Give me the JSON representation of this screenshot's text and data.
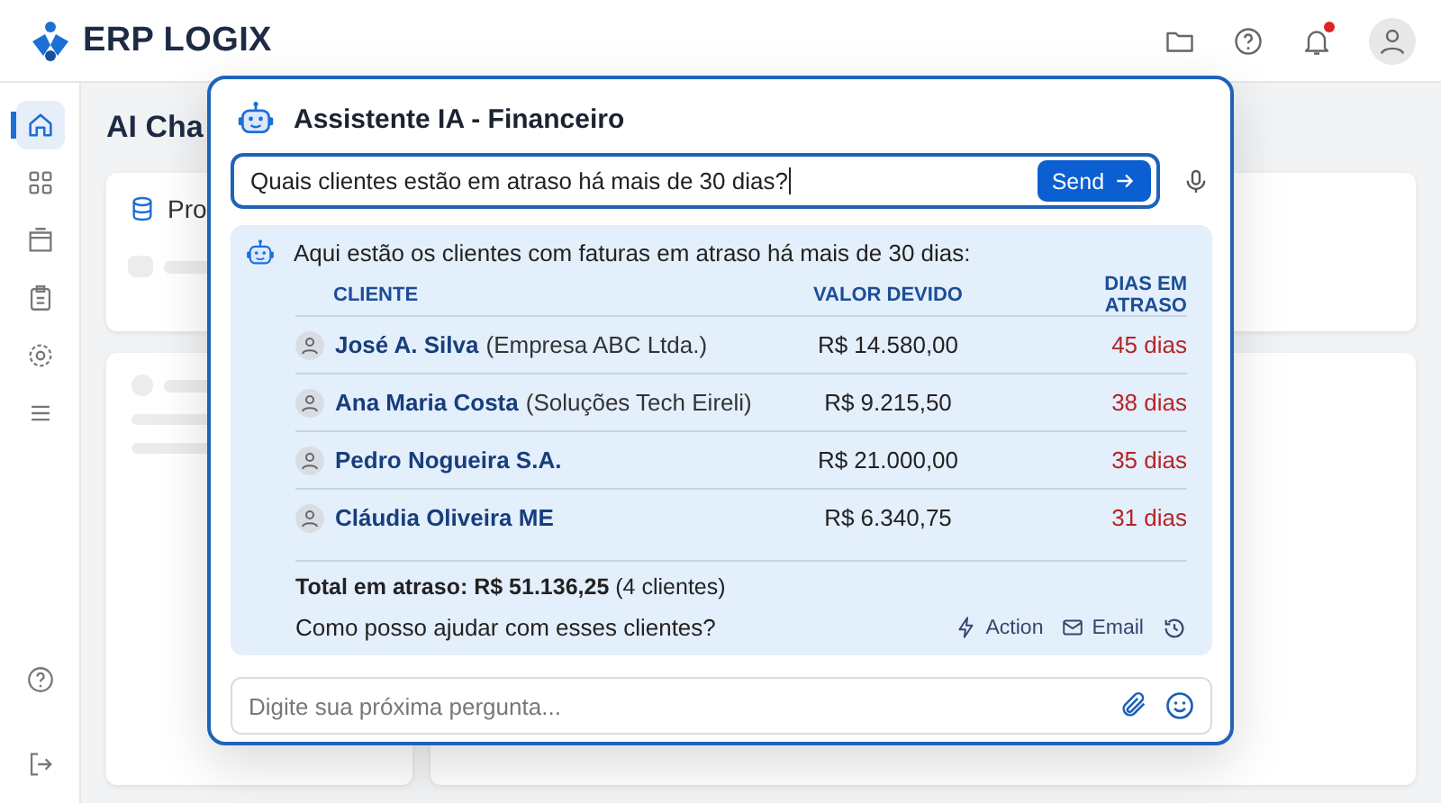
{
  "app": {
    "logo_text": "ERP LOGIX"
  },
  "sidebar": {
    "items": [
      {
        "selected": true
      },
      {
        "selected": false
      },
      {
        "selected": false
      },
      {
        "selected": false
      },
      {
        "selected": false
      },
      {
        "selected": false
      }
    ]
  },
  "header": {
    "notifications_unread": true
  },
  "page": {
    "title": "AI Cha",
    "card_title": "Pro"
  },
  "assistant": {
    "title": "Assistente IA - Financeiro",
    "query": "Quais clientes estão em atraso há mais de 30 dias?",
    "send_label": "Send",
    "intro": "Aqui estão os clientes com faturas em atraso há mais de 30 dias:",
    "columns": [
      "CLIENTE",
      "VALOR DEVIDO",
      "DIAS EM ATRASO"
    ],
    "rows": [
      {
        "name": "José A. Silva",
        "company": "(Empresa ABC Ltda.)",
        "amount": "R$ 14.580,00",
        "days": "45 dias"
      },
      {
        "name": "Ana Maria Costa",
        "company": "(Soluções Tech Eireli)",
        "amount": "R$ 9.215,50",
        "days": "38 dias"
      },
      {
        "name": "Pedro Nogueira S.A.",
        "amount": "R$ 21.000,00",
        "days": "35 dias"
      },
      {
        "name": "Cláudia Oliveira ME",
        "amount": "R$ 6.340,75",
        "days": "31 dias"
      }
    ],
    "total": "**Total em atraso: R$ 51.136,25** (4 clientes)",
    "followup": "Como posso ajudar com esses clientes?",
    "actions": [
      {
        "kind": "action",
        "label": "Action"
      },
      {
        "kind": "email",
        "label": "Email"
      },
      {
        "kind": "history"
      }
    ],
    "next_placeholder": "Digite sua próxima pergunta..."
  }
}
